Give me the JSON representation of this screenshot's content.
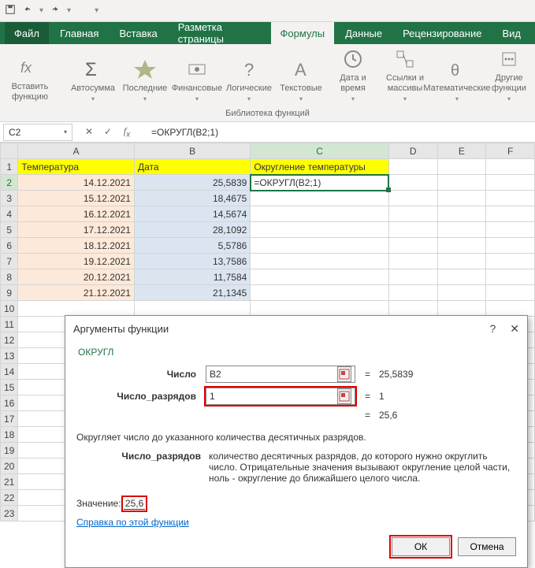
{
  "qat": {
    "dropdown_glyph": "▾"
  },
  "tabs": {
    "file": "Файл",
    "items": [
      "Главная",
      "Вставка",
      "Разметка страницы",
      "Формулы",
      "Данные",
      "Рецензирование",
      "Вид"
    ],
    "active_index": 3
  },
  "ribbon": {
    "buttons": [
      {
        "label": "Вставить\nфункцию"
      },
      {
        "label": "Автосумма"
      },
      {
        "label": "Последние"
      },
      {
        "label": "Финансовые"
      },
      {
        "label": "Логические"
      },
      {
        "label": "Текстовые"
      },
      {
        "label": "Дата и\nвремя"
      },
      {
        "label": "Ссылки и\nмассивы"
      },
      {
        "label": "Математические"
      },
      {
        "label": "Другие\nфункции"
      }
    ],
    "group_caption": "Библиотека функций"
  },
  "namebox": "C2",
  "formula": "=ОКРУГЛ(B2;1)",
  "columns": [
    "A",
    "B",
    "C",
    "D",
    "E",
    "F"
  ],
  "headers": {
    "A": "Температура",
    "B": "Дата",
    "C": "Округление температуры"
  },
  "rows": [
    {
      "n": 1
    },
    {
      "n": 2,
      "a": "14.12.2021",
      "b": "25,5839",
      "c": "=ОКРУГЛ(B2;1)"
    },
    {
      "n": 3,
      "a": "15.12.2021",
      "b": "18,4675"
    },
    {
      "n": 4,
      "a": "16.12.2021",
      "b": "14,5674"
    },
    {
      "n": 5,
      "a": "17.12.2021",
      "b": "28,1092"
    },
    {
      "n": 6,
      "a": "18.12.2021",
      "b": "5,5786"
    },
    {
      "n": 7,
      "a": "19.12.2021",
      "b": "13,7586"
    },
    {
      "n": 8,
      "a": "20.12.2021",
      "b": "11,7584"
    },
    {
      "n": 9,
      "a": "21.12.2021",
      "b": "21,1345"
    },
    {
      "n": 10
    },
    {
      "n": 11
    },
    {
      "n": 12
    },
    {
      "n": 13
    },
    {
      "n": 14
    },
    {
      "n": 15
    },
    {
      "n": 16
    },
    {
      "n": 17
    },
    {
      "n": 18
    },
    {
      "n": 19
    },
    {
      "n": 20
    },
    {
      "n": 21
    },
    {
      "n": 22
    },
    {
      "n": 23
    }
  ],
  "dialog": {
    "title": "Аргументы функции",
    "func": "ОКРУГЛ",
    "arg1_label": "Число",
    "arg1_value": "B2",
    "arg1_result": "25,5839",
    "arg2_label": "Число_разрядов",
    "arg2_value": "1",
    "arg2_result": "1",
    "preview": "25,6",
    "description": "Округляет число до указанного количества десятичных разрядов.",
    "param_name": "Число_разрядов",
    "param_desc": "количество десятичных разрядов, до которого нужно округлить число. Отрицательные значения вызывают округление целой части, ноль - округление до ближайшего целого числа.",
    "result_label": "Значение:",
    "result_value": "25,6",
    "help": "Справка по этой функции",
    "ok": "ОК",
    "cancel": "Отмена",
    "eq": "="
  }
}
